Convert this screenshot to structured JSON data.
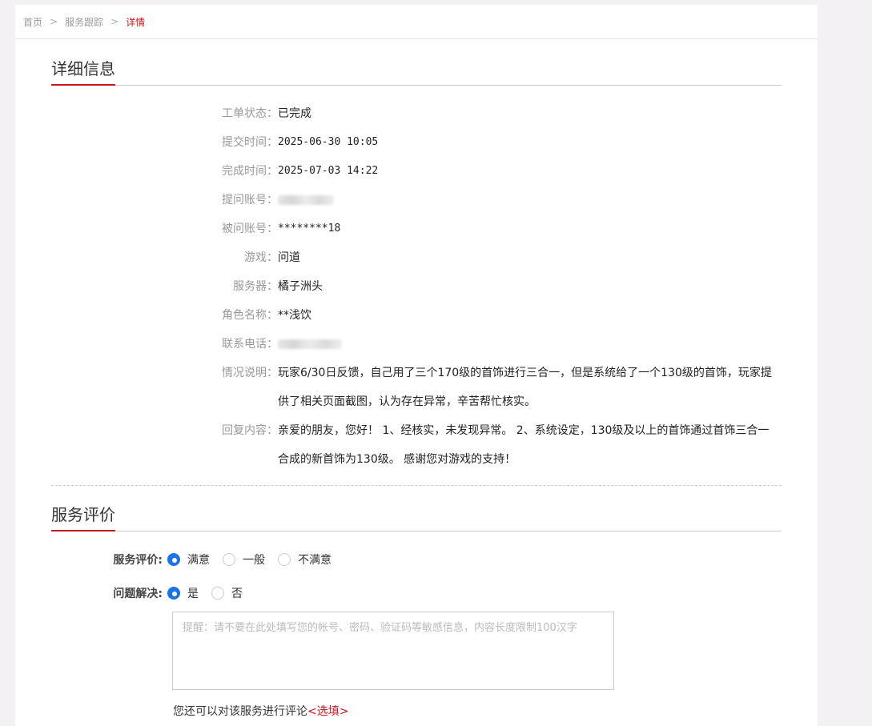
{
  "breadcrumb": {
    "home": "首页",
    "sep": ">",
    "tracking": "服务跟踪",
    "current": "详情"
  },
  "detail": {
    "title": "详细信息",
    "rows": [
      {
        "label": "工单状态：",
        "value": "已完成"
      },
      {
        "label": "提交时间：",
        "value": "2025-06-30 10:05"
      },
      {
        "label": "完成时间：",
        "value": "2025-07-03 14:22"
      },
      {
        "label": "提问账号：",
        "value": ""
      },
      {
        "label": "被问账号：",
        "value": "********18"
      },
      {
        "label": "游戏：",
        "value": "问道"
      },
      {
        "label": "服务器：",
        "value": "橘子洲头"
      },
      {
        "label": "角色名称：",
        "value": "**浅饮"
      },
      {
        "label": "联系电话：",
        "value": ""
      },
      {
        "label": "情况说明：",
        "value": "玩家6/30日反馈，自己用了三个170级的首饰进行三合一，但是系统给了一个130级的首饰，玩家提供了相关页面截图，认为存在异常，辛苦帮忙核实。"
      },
      {
        "label": "回复内容：",
        "value": "亲爱的朋友，您好！ 1、经核实，未发现异常。 2、系统设定，130级及以上的首饰通过首饰三合一合成的新首饰为130级。 感谢您对游戏的支持！"
      }
    ]
  },
  "evaluation": {
    "title": "服务评价",
    "rating_label": "服务评价:",
    "rating_options": [
      "满意",
      "一般",
      "不满意"
    ],
    "rating_selected": "满意",
    "solved_label": "问题解决:",
    "solved_options": [
      "是",
      "否"
    ],
    "solved_selected": "是",
    "comment_placeholder": "提醒：请不要在此处填写您的帐号、密码、验证码等敏感信息，内容长度限制100汉字",
    "hint_text": "您还可以对该服务进行评论",
    "hint_optional": "<选填>"
  },
  "colors": {
    "accent": "#c8161d",
    "radio": "#1a73e8"
  }
}
